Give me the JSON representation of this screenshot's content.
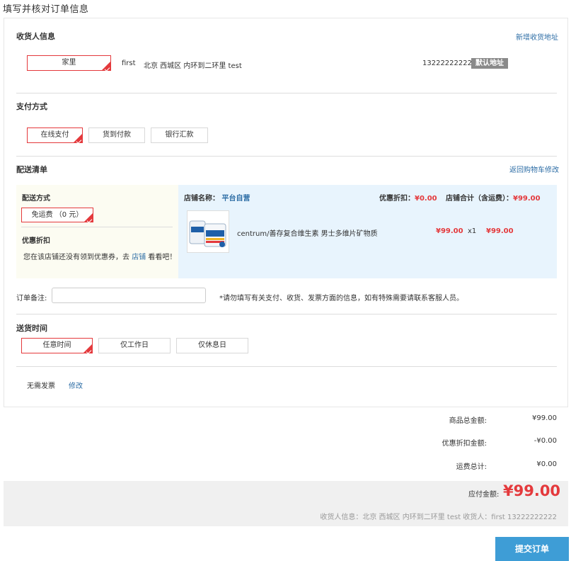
{
  "page": {
    "title": "填写并核对订单信息"
  },
  "receiver": {
    "section_title": "收货人信息",
    "add_link": "新增收货地址",
    "address_tag": "家里",
    "name": "first",
    "address": "北京 西城区 内环到二环里 test",
    "phone": "13222222222",
    "default_badge": "默认地址"
  },
  "payment": {
    "section_title": "支付方式",
    "options": [
      "在线支付",
      "货到付款",
      "银行汇款"
    ],
    "selected": "在线支付"
  },
  "delivery_list": {
    "section_title": "配送清单",
    "return_link": "返回购物车修改",
    "shipping_method_label": "配送方式",
    "shipping_option": "免运费 （0 元）",
    "discount_label": "优惠折扣",
    "discount_note_prefix": "您在该店铺还没有领到优惠券，去",
    "discount_note_link": "店铺",
    "discount_note_suffix": "看看吧！",
    "store_name_label": "店铺名称：",
    "store_name": "平台自营",
    "discount_label_right": "优惠折扣：",
    "discount_value": "¥0.00",
    "store_total_label": "店铺合计（含运费）：",
    "store_total_value": "¥99.00",
    "product": {
      "name": "centrum/善存复合维生素 男士多维片矿物质",
      "price": "¥99.00",
      "quantity": "x1",
      "subtotal": "¥99.00",
      "image_text": "Centrum"
    }
  },
  "memo": {
    "label": "订单备注:",
    "value": "",
    "placeholder": "",
    "note": "*请勿填写有关支付、收货、发票方面的信息，如有特殊需要请联系客服人员。"
  },
  "delivery_time": {
    "section_title": "送货时间",
    "options": [
      "任意时间",
      "仅工作日",
      "仅休息日"
    ],
    "selected": "任意时间"
  },
  "invoice": {
    "text": "无需发票",
    "modify_link": "修改"
  },
  "summary": {
    "goods_total_label": "商品总金额:",
    "goods_total": "¥99.00",
    "discount_label": "优惠折扣金额:",
    "discount": "-¥0.00",
    "shipping_label": "运费总计:",
    "shipping": "¥0.00",
    "payable_label": "应付金额:",
    "payable": "¥99.00",
    "receiver_info": "收货人信息：北京 西城区 内环到二环里 test  收货人：first 13222222222"
  },
  "submit_label": "提交订单",
  "colors": {
    "accent_red": "#e4393c",
    "submit_blue": "#3e9dd6",
    "link_blue": "#2e6ea6"
  }
}
